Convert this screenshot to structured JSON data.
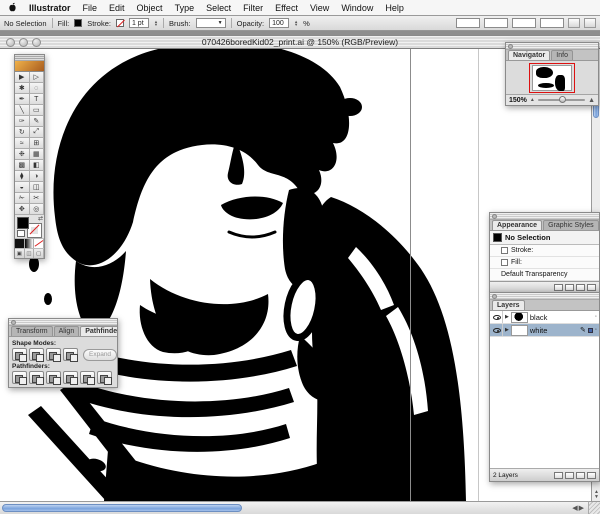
{
  "colors": {
    "aqua_thumb_blue": "#7aa3dd",
    "selected_layer_blue": "#9db4cc",
    "navigator_viewbox_red": "#dd1111",
    "stroke_none_red": "#dd2222",
    "artwork_ink": "#000000"
  },
  "menu_bar": {
    "app_name": "Illustrator",
    "items": [
      "File",
      "Edit",
      "Object",
      "Type",
      "Select",
      "Filter",
      "Effect",
      "View",
      "Window",
      "Help"
    ]
  },
  "control_bar": {
    "selection_status": "No Selection",
    "fill_label": "Fill:",
    "stroke_label": "Stroke:",
    "stroke_weight_value": "1 pt",
    "brush_label": "Brush:",
    "opacity_label": "Opacity:",
    "opacity_value": "100",
    "opacity_unit": "%"
  },
  "document_window": {
    "title": "070426boredKid02_print.ai @ 150% (RGB/Preview)"
  },
  "toolbox": {
    "tools": [
      {
        "name": "selection-tool",
        "glyph": "▶"
      },
      {
        "name": "direct-selection-tool",
        "glyph": "▷"
      },
      {
        "name": "magic-wand-tool",
        "glyph": "✱"
      },
      {
        "name": "lasso-tool",
        "glyph": "◌"
      },
      {
        "name": "pen-tool",
        "glyph": "✒"
      },
      {
        "name": "type-tool",
        "glyph": "T"
      },
      {
        "name": "line-segment-tool",
        "glyph": "╲"
      },
      {
        "name": "rectangle-tool",
        "glyph": "▭"
      },
      {
        "name": "paintbrush-tool",
        "glyph": "✑"
      },
      {
        "name": "pencil-tool",
        "glyph": "✎"
      },
      {
        "name": "rotate-tool",
        "glyph": "↻"
      },
      {
        "name": "scale-tool",
        "glyph": "⤢"
      },
      {
        "name": "warp-tool",
        "glyph": "≈"
      },
      {
        "name": "free-transform-tool",
        "glyph": "⊞"
      },
      {
        "name": "symbol-sprayer-tool",
        "glyph": "❉"
      },
      {
        "name": "column-graph-tool",
        "glyph": "▦"
      },
      {
        "name": "mesh-tool",
        "glyph": "▩"
      },
      {
        "name": "gradient-tool",
        "glyph": "◧"
      },
      {
        "name": "eyedropper-tool",
        "glyph": "⧫"
      },
      {
        "name": "blend-tool",
        "glyph": "◑"
      },
      {
        "name": "live-paint-bucket-tool",
        "glyph": "◒"
      },
      {
        "name": "live-paint-selection-tool",
        "glyph": "◫"
      },
      {
        "name": "slice-tool",
        "glyph": "✁"
      },
      {
        "name": "scissors-tool",
        "glyph": "✂"
      },
      {
        "name": "hand-tool",
        "glyph": "✥"
      },
      {
        "name": "zoom-tool",
        "glyph": "◎"
      }
    ]
  },
  "navigator_palette": {
    "tabs": [
      "Navigator",
      "Info"
    ],
    "zoom_value": "150%"
  },
  "appearance_palette": {
    "tabs": [
      "Appearance",
      "Graphic Styles"
    ],
    "selection_title": "No Selection",
    "rows": [
      {
        "label": "Stroke:"
      },
      {
        "label": "Fill:"
      },
      {
        "label": "Default Transparency"
      }
    ]
  },
  "layers_palette": {
    "tab": "Layers",
    "layers": [
      {
        "name": "black"
      },
      {
        "name": "white"
      }
    ],
    "status": "2 Layers"
  },
  "pathfinder_palette": {
    "tabs": [
      "Transform",
      "Align",
      "Pathfinder"
    ],
    "shape_modes_label": "Shape Modes:",
    "expand_button_label": "Expand",
    "pathfinders_label": "Pathfinders:"
  }
}
